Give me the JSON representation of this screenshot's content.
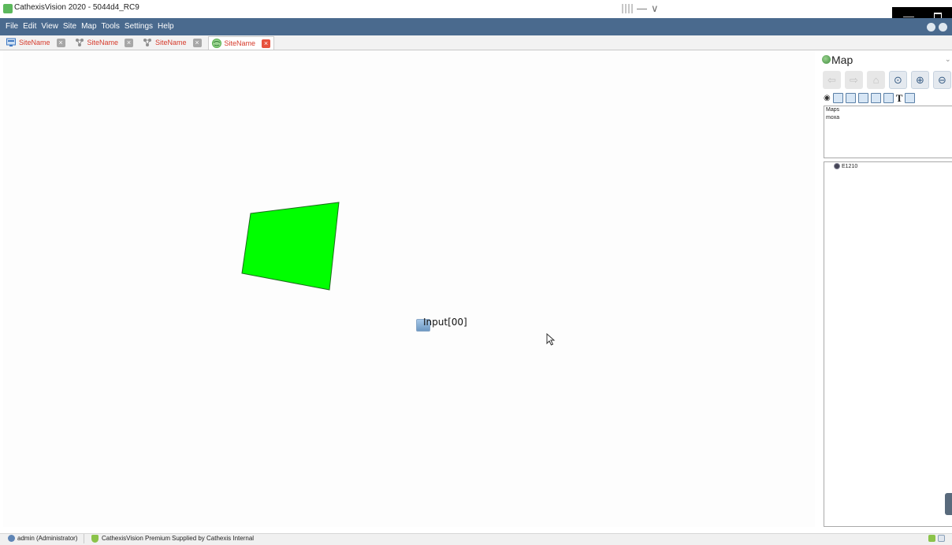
{
  "app": {
    "title": "CathexisVision 2020 - 5044d4_RC9"
  },
  "title_controls": {
    "grid_icon": "grid-icon",
    "minus_glyph": "—",
    "chevron_glyph": "∨"
  },
  "window_controls": {
    "minimize_glyph": "—"
  },
  "menu": {
    "items": [
      "File",
      "Edit",
      "View",
      "Site",
      "Map",
      "Tools",
      "Settings",
      "Help"
    ]
  },
  "tabs": [
    {
      "label": "SiteName",
      "icon": "monitor-icon",
      "icon_color": "#3f78c2",
      "active": false
    },
    {
      "label": "SiteName",
      "icon": "network-icon",
      "icon_color": "#8f8f8f",
      "active": false
    },
    {
      "label": "SiteName",
      "icon": "network-icon",
      "icon_color": "#8f8f8f",
      "active": false
    },
    {
      "label": "SiteName",
      "icon": "globe-icon",
      "icon_color": "#55b04a",
      "active": true
    }
  ],
  "tab_close_glyph": "×",
  "map": {
    "zone_color": "#00ff00",
    "input_label": "Input[00]"
  },
  "panel": {
    "title": "Map",
    "collapse_glyph": "⌄",
    "nav_buttons": [
      {
        "name": "back",
        "glyph": "⇦",
        "enabled": false
      },
      {
        "name": "forward",
        "glyph": "⇨",
        "enabled": false
      },
      {
        "name": "home",
        "glyph": "⌂",
        "enabled": false
      },
      {
        "name": "zoom-fit",
        "glyph": "⊙",
        "enabled": true
      },
      {
        "name": "zoom-in",
        "glyph": "⊕",
        "enabled": true
      },
      {
        "name": "zoom-out",
        "glyph": "⊖",
        "enabled": true
      }
    ],
    "text_tool_glyph": "T",
    "eye_glyph": "◉",
    "maps_list": [
      "Maps",
      "moxa"
    ],
    "tree_items": [
      "E1210"
    ]
  },
  "status": {
    "user": "admin (Administrator)",
    "edition": "CathexisVision Premium",
    "supplied": "Supplied by Cathexis Internal"
  },
  "colors": {
    "menu_bar": "#4a6a8e",
    "tab_label": "#d63a2b",
    "tab_close_active": "#e7523d"
  }
}
